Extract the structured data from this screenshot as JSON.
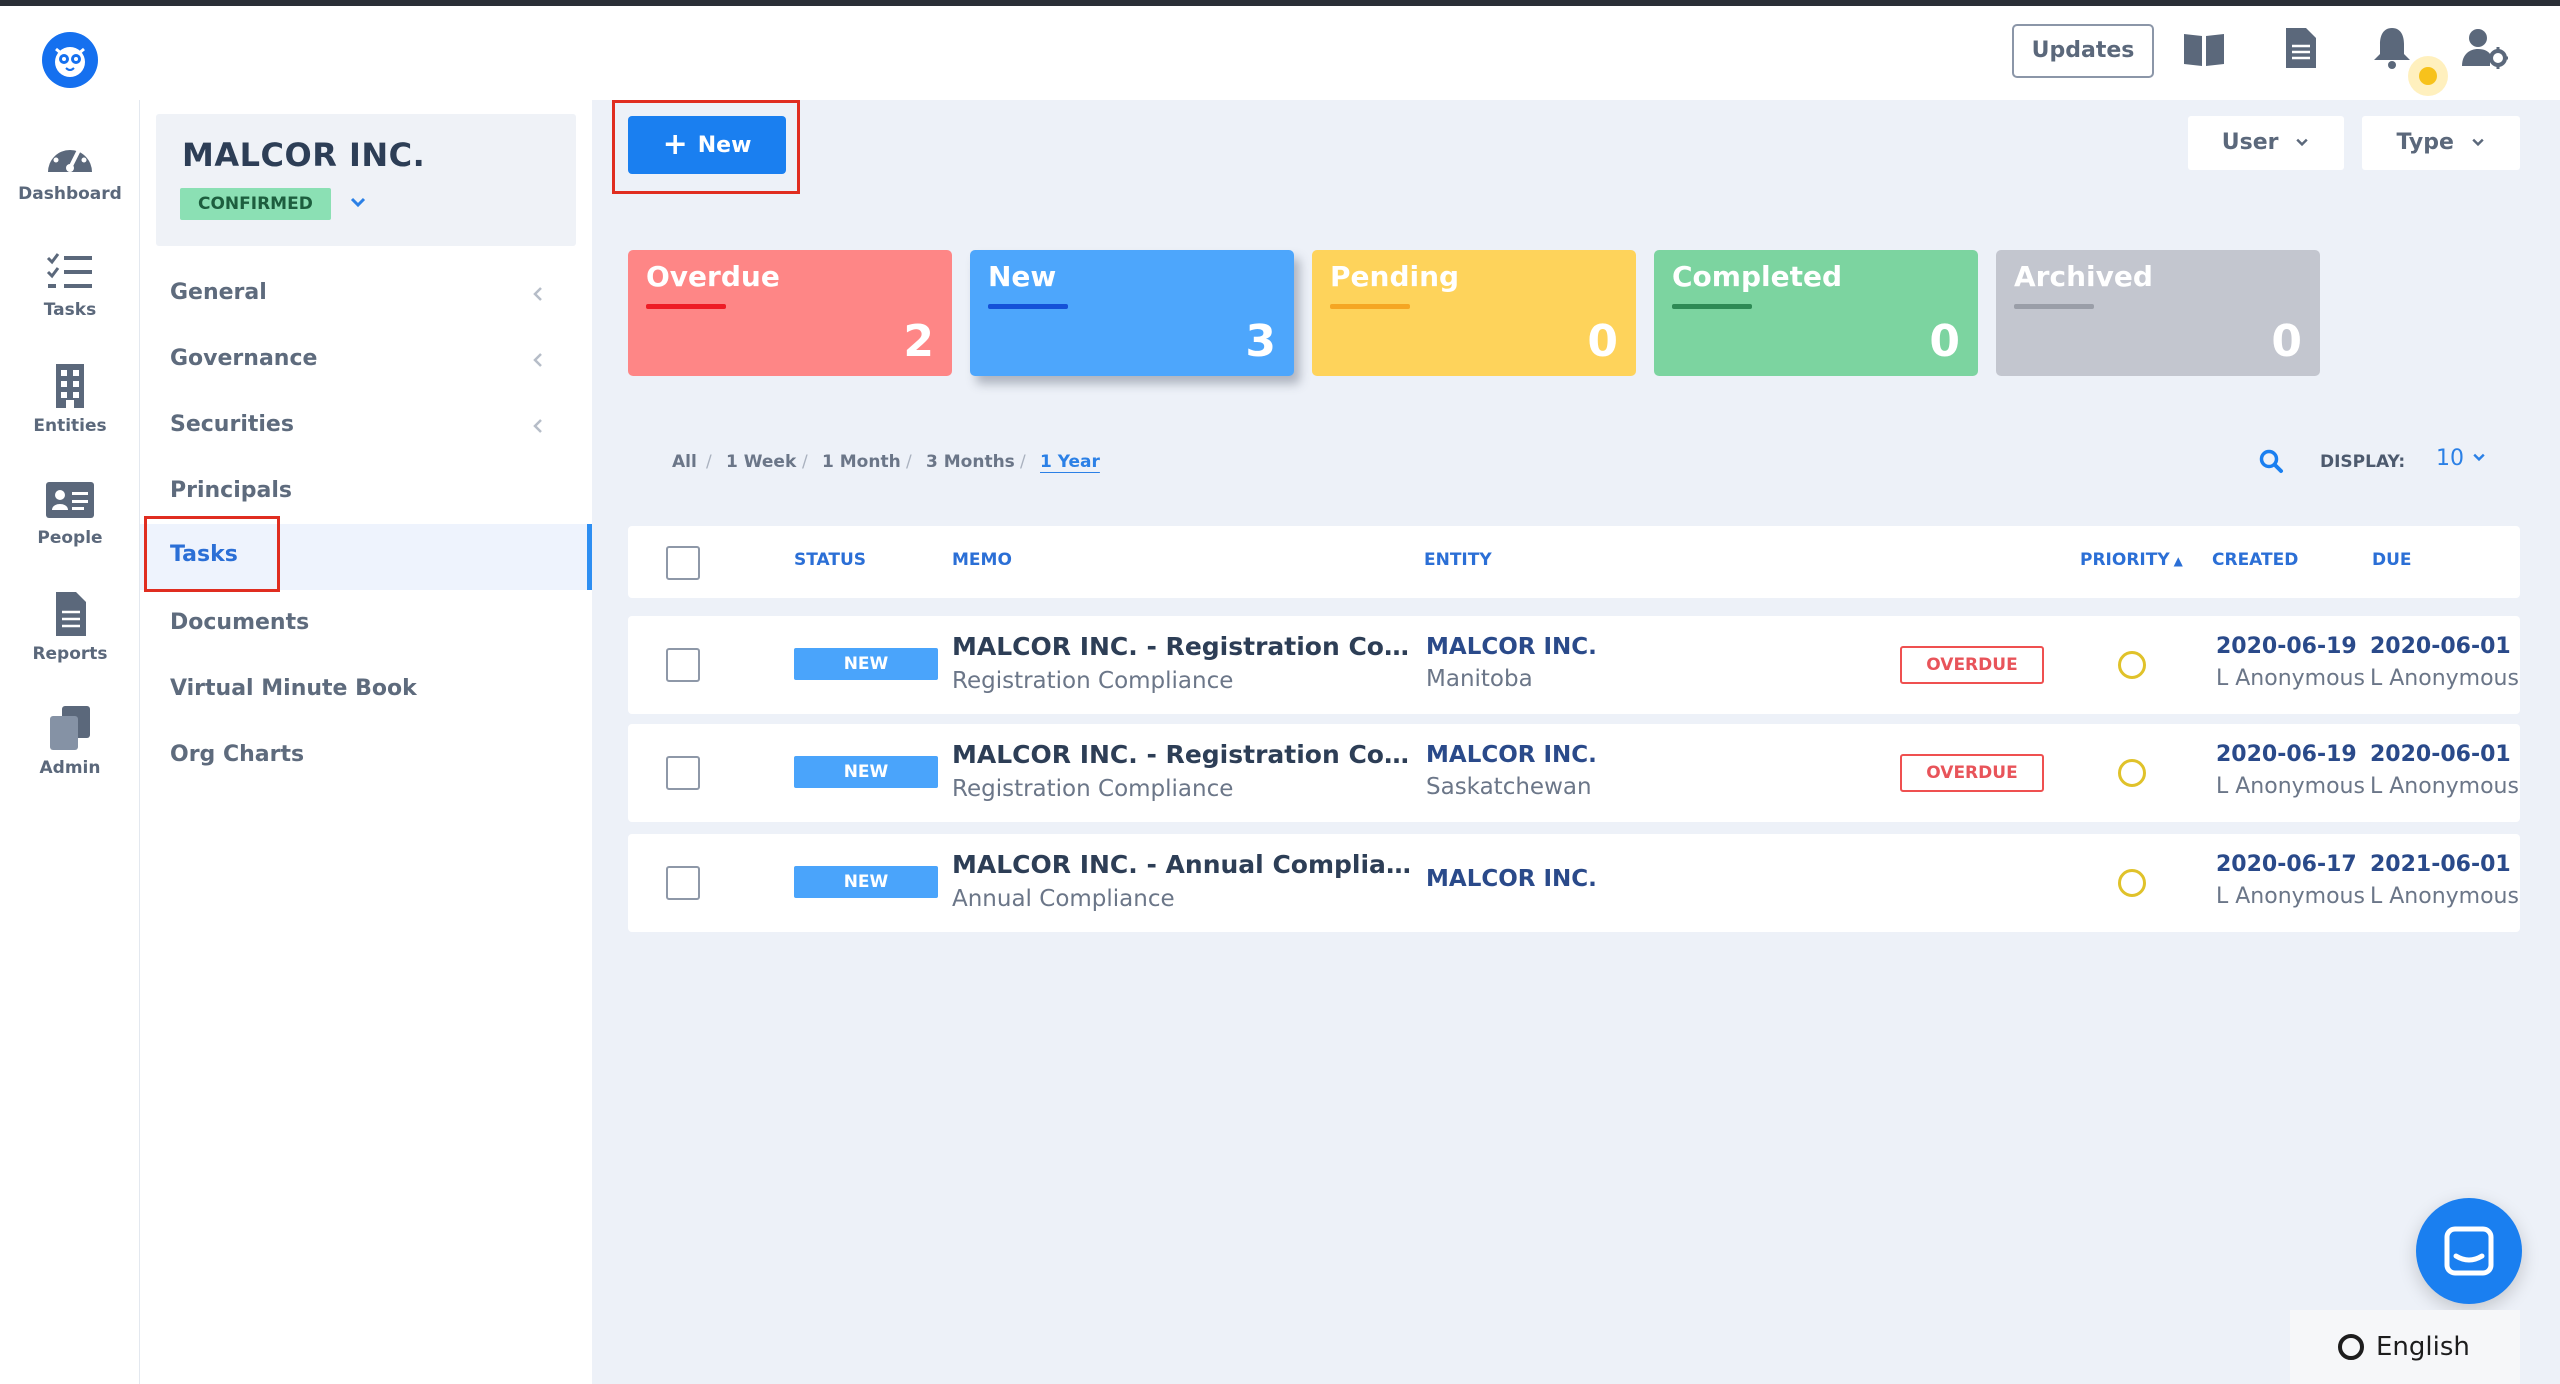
{
  "header": {
    "updates_label": "Updates",
    "icons": [
      "book-icon",
      "document-icon",
      "bell-icon",
      "user-settings-icon"
    ]
  },
  "leftnav": {
    "items": [
      {
        "label": "Dashboard",
        "icon": "speedometer-icon"
      },
      {
        "label": "Tasks",
        "icon": "checklist-icon"
      },
      {
        "label": "Entities",
        "icon": "building-icon"
      },
      {
        "label": "People",
        "icon": "id-card-icon"
      },
      {
        "label": "Reports",
        "icon": "report-icon"
      },
      {
        "label": "Admin",
        "icon": "copy-icon"
      }
    ]
  },
  "company": {
    "name": "MALCOR INC.",
    "status": "CONFIRMED"
  },
  "subnav": {
    "items": [
      {
        "label": "General",
        "has_chevron": true
      },
      {
        "label": "Governance",
        "has_chevron": true
      },
      {
        "label": "Securities",
        "has_chevron": true
      },
      {
        "label": "Principals",
        "has_chevron": false
      },
      {
        "label": "Tasks",
        "has_chevron": false,
        "active": true
      },
      {
        "label": "Documents",
        "has_chevron": false
      },
      {
        "label": "Virtual Minute Book",
        "has_chevron": false
      },
      {
        "label": "Org Charts",
        "has_chevron": false
      }
    ]
  },
  "toolbar": {
    "new_label": "New",
    "user_filter": "User",
    "type_filter": "Type"
  },
  "stats": [
    {
      "label": "Overdue",
      "count": "2",
      "color": "#fe8686",
      "accent": "#ee1c25"
    },
    {
      "label": "New",
      "count": "3",
      "color": "#4da6fc",
      "accent": "#1451d8"
    },
    {
      "label": "Pending",
      "count": "0",
      "color": "#fed35b",
      "accent": "#f5a623"
    },
    {
      "label": "Completed",
      "count": "0",
      "color": "#7cd4a0",
      "accent": "#2e8a55"
    },
    {
      "label": "Archived",
      "count": "0",
      "color": "#c3c6cf",
      "accent": "#9a9ea8"
    }
  ],
  "ranges": {
    "all": "All",
    "week": "1 Week",
    "month": "1 Month",
    "three_months": "3 Months",
    "year": "1 Year",
    "active": "1 Year"
  },
  "display": {
    "label": "DISPLAY:",
    "value": "10"
  },
  "table": {
    "columns": {
      "status": "STATUS",
      "memo": "MEMO",
      "entity": "ENTITY",
      "priority": "PRIORITY",
      "created": "CREATED",
      "due": "DUE"
    },
    "rows": [
      {
        "status": "NEW",
        "memo_title": "MALCOR INC. - Registration Compliance",
        "memo_sub": "Registration Compliance",
        "entity": "MALCOR INC.",
        "entity_sub": "Manitoba",
        "overdue": "OVERDUE",
        "created": "2020-06-19",
        "created_by": "L Anonymous",
        "due": "2020-06-01",
        "due_by": "L Anonymous"
      },
      {
        "status": "NEW",
        "memo_title": "MALCOR INC. - Registration Compliance",
        "memo_sub": "Registration Compliance",
        "entity": "MALCOR INC.",
        "entity_sub": "Saskatchewan",
        "overdue": "OVERDUE",
        "created": "2020-06-19",
        "created_by": "L Anonymous",
        "due": "2020-06-01",
        "due_by": "L Anonymous"
      },
      {
        "status": "NEW",
        "memo_title": "MALCOR INC. - Annual Compliance",
        "memo_sub": "Annual Compliance",
        "entity": "MALCOR INC.",
        "entity_sub": "",
        "overdue": "",
        "created": "2020-06-17",
        "created_by": "L Anonymous",
        "due": "2021-06-01",
        "due_by": "L Anonymous"
      }
    ]
  },
  "footer": {
    "language": "English"
  }
}
